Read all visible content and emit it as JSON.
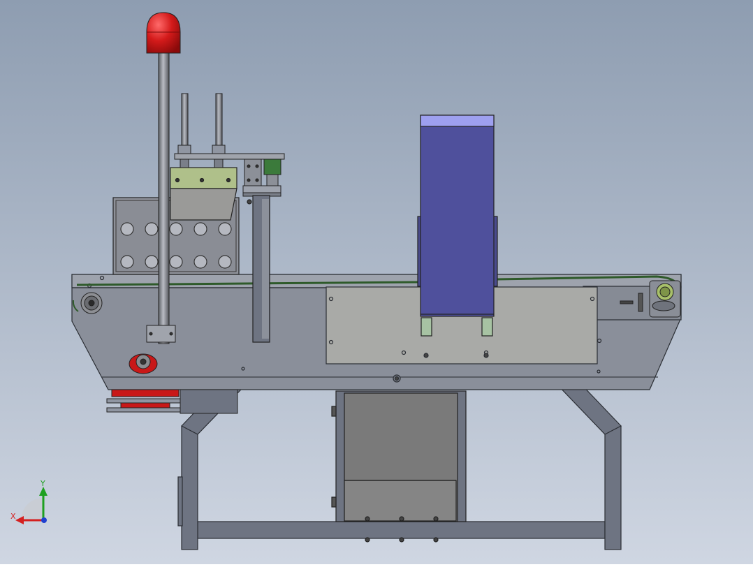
{
  "viewport": {
    "background_top": "#8E9DB1",
    "background_bottom": "#CFD6E2"
  },
  "colors": {
    "frame": "#6E7482",
    "frame_light": "#9096A2",
    "frame_outline": "#2A2D33",
    "panel_gray": "#A8A9A6",
    "panel_dark": "#7A7A7A",
    "belt_green": "#2E5A2A",
    "detector_blue": "#4F509C",
    "detector_top": "#9EA0F0",
    "red": "#D31A1A",
    "green_block": "#AFC08A",
    "leg_green": "#A7C3A3"
  },
  "triad": {
    "x_label": "X",
    "y_label": "Y",
    "x_color": "#D42020",
    "y_color": "#1EA020",
    "z_color": "#2040D0"
  }
}
